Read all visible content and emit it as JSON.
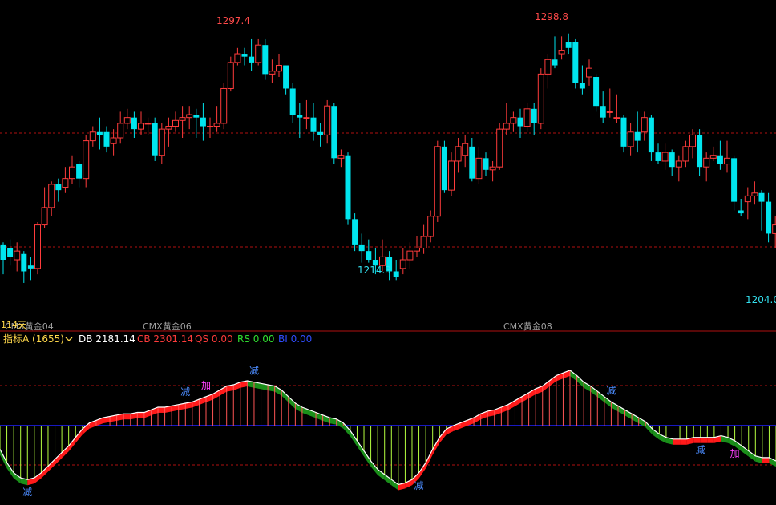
{
  "colors": {
    "background": "#000000",
    "up": "#ff3b3b",
    "down": "#00e5ee",
    "grid": "#b01010",
    "separator": "#b01010",
    "zero_line": "#2020ff",
    "ind_fill_up": "#ff1a1a",
    "ind_fill_down": "#1a8f1a",
    "ind_line": "#ffffff",
    "tick_up": "#ff5555",
    "tick_down": "#b6ff40",
    "label_grey": "#a0a0a0"
  },
  "price_panel": {
    "high_label": "1297.4",
    "high2_label": "1298.8",
    "low_label": "1214.3",
    "low2_label": "1204.0",
    "segment_labels": [
      "CMX黄金04",
      "CMX黄金06",
      "CMX黄金08"
    ],
    "small_overlap_label": "114天"
  },
  "indicator_panel": {
    "name": "指标A (1655)",
    "db_label": "DB 2181.14",
    "cb_label": "CB 2301.14",
    "qs_label": "QS 0.00",
    "rs_label": "RS 0.00",
    "bi_label": "BI 0.00",
    "signals": [
      {
        "text": "减",
        "i": 4,
        "color": "#4c8cff"
      },
      {
        "text": "减",
        "i": 27,
        "color": "#4c8cff"
      },
      {
        "text": "加",
        "i": 30,
        "color": "#ff40ff"
      },
      {
        "text": "减",
        "i": 37,
        "color": "#4c8cff"
      },
      {
        "text": "减",
        "i": 61,
        "color": "#4c8cff"
      },
      {
        "text": "减",
        "i": 89,
        "color": "#4c8cff"
      },
      {
        "text": "减",
        "i": 102,
        "color": "#4c8cff"
      },
      {
        "text": "加",
        "i": 107,
        "color": "#ff40ff"
      }
    ]
  },
  "chart_data": {
    "type": "candlestick",
    "candles": [
      [
        1226,
        1221,
        1227,
        1216
      ],
      [
        1225,
        1222,
        1228,
        1219
      ],
      [
        1221,
        1224,
        1227,
        1217
      ],
      [
        1223,
        1217,
        1224,
        1213
      ],
      [
        1219,
        1218,
        1222,
        1214
      ],
      [
        1218,
        1233,
        1234,
        1216
      ],
      [
        1233,
        1239,
        1246,
        1232
      ],
      [
        1239,
        1247,
        1248,
        1236
      ],
      [
        1247,
        1245,
        1249,
        1241
      ],
      [
        1246,
        1249,
        1253,
        1244
      ],
      [
        1249,
        1253,
        1257,
        1247
      ],
      [
        1254,
        1249,
        1255,
        1246
      ],
      [
        1249,
        1262,
        1264,
        1246
      ],
      [
        1262,
        1265,
        1267,
        1260
      ],
      [
        1265,
        1264,
        1270,
        1259
      ],
      [
        1265,
        1260,
        1267,
        1258
      ],
      [
        1261,
        1263,
        1266,
        1257
      ],
      [
        1263,
        1268,
        1272,
        1261
      ],
      [
        1268,
        1270,
        1273,
        1266
      ],
      [
        1270,
        1266,
        1272,
        1263
      ],
      [
        1266,
        1268,
        1272,
        1264
      ],
      [
        1268,
        1268,
        1270,
        1264
      ],
      [
        1268,
        1257,
        1270,
        1255
      ],
      [
        1257,
        1266,
        1268,
        1254
      ],
      [
        1266,
        1267,
        1270,
        1260
      ],
      [
        1267,
        1269,
        1272,
        1265
      ],
      [
        1269,
        1270,
        1274,
        1263
      ],
      [
        1270,
        1271,
        1274,
        1266
      ],
      [
        1271,
        1270,
        1273,
        1263
      ],
      [
        1270,
        1267,
        1275,
        1262
      ],
      [
        1267,
        1267,
        1270,
        1263
      ],
      [
        1267,
        1268,
        1274,
        1265
      ],
      [
        1268,
        1280,
        1282,
        1266
      ],
      [
        1280,
        1289,
        1291,
        1279
      ],
      [
        1289,
        1292,
        1294,
        1288
      ],
      [
        1292,
        1291,
        1294,
        1288
      ],
      [
        1291,
        1289,
        1297,
        1286
      ],
      [
        1289,
        1295,
        1297,
        1288
      ],
      [
        1295,
        1285,
        1297,
        1283
      ],
      [
        1285,
        1286,
        1290,
        1282
      ],
      [
        1286,
        1288,
        1292,
        1284
      ],
      [
        1288,
        1280,
        1288,
        1278
      ],
      [
        1280,
        1271,
        1282,
        1268
      ],
      [
        1271,
        1270,
        1275,
        1263
      ],
      [
        1270,
        1270,
        1276,
        1266
      ],
      [
        1270,
        1265,
        1275,
        1262
      ],
      [
        1265,
        1264,
        1268,
        1260
      ],
      [
        1264,
        1274,
        1276,
        1261
      ],
      [
        1274,
        1256,
        1275,
        1254
      ],
      [
        1256,
        1257,
        1259,
        1253
      ],
      [
        1257,
        1235,
        1258,
        1233
      ],
      [
        1235,
        1226,
        1237,
        1224
      ],
      [
        1226,
        1224,
        1230,
        1220
      ],
      [
        1224,
        1221,
        1228,
        1220
      ],
      [
        1221,
        1219,
        1225,
        1216
      ],
      [
        1219,
        1222,
        1228,
        1217
      ],
      [
        1222,
        1217,
        1224,
        1214
      ],
      [
        1217,
        1215,
        1221,
        1214
      ],
      [
        1218,
        1221,
        1225,
        1216
      ],
      [
        1221,
        1224,
        1227,
        1218
      ],
      [
        1224,
        1225,
        1229,
        1222
      ],
      [
        1225,
        1229,
        1233,
        1223
      ],
      [
        1229,
        1236,
        1238,
        1227
      ],
      [
        1236,
        1260,
        1262,
        1234
      ],
      [
        1260,
        1245,
        1262,
        1244
      ],
      [
        1245,
        1255,
        1258,
        1243
      ],
      [
        1255,
        1260,
        1263,
        1251
      ],
      [
        1257,
        1261,
        1264,
        1253
      ],
      [
        1260,
        1249,
        1263,
        1248
      ],
      [
        1249,
        1256,
        1260,
        1247
      ],
      [
        1256,
        1252,
        1258,
        1250
      ],
      [
        1252,
        1253,
        1255,
        1248
      ],
      [
        1253,
        1266,
        1268,
        1252
      ],
      [
        1266,
        1268,
        1275,
        1264
      ],
      [
        1268,
        1270,
        1272,
        1265
      ],
      [
        1270,
        1267,
        1273,
        1263
      ],
      [
        1267,
        1273,
        1275,
        1265
      ],
      [
        1273,
        1268,
        1275,
        1264
      ],
      [
        1268,
        1285,
        1287,
        1266
      ],
      [
        1285,
        1290,
        1292,
        1280
      ],
      [
        1290,
        1288,
        1298,
        1287
      ],
      [
        1292,
        1293,
        1298,
        1290
      ],
      [
        1296,
        1294,
        1299,
        1292
      ],
      [
        1296,
        1282,
        1297,
        1280
      ],
      [
        1282,
        1280,
        1288,
        1278
      ],
      [
        1284,
        1287,
        1290,
        1281
      ],
      [
        1284,
        1274,
        1285,
        1272
      ],
      [
        1274,
        1270,
        1279,
        1268
      ],
      [
        1272,
        1272,
        1280,
        1270
      ],
      [
        1270,
        1270,
        1278,
        1268
      ],
      [
        1270,
        1260,
        1271,
        1258
      ],
      [
        1260,
        1265,
        1268,
        1257
      ],
      [
        1265,
        1262,
        1272,
        1258
      ],
      [
        1265,
        1270,
        1272,
        1262
      ],
      [
        1270,
        1258,
        1271,
        1255
      ],
      [
        1258,
        1255,
        1261,
        1254
      ],
      [
        1255,
        1258,
        1261,
        1252
      ],
      [
        1258,
        1253,
        1259,
        1250
      ],
      [
        1253,
        1255,
        1257,
        1248
      ],
      [
        1255,
        1260,
        1262,
        1253
      ],
      [
        1260,
        1264,
        1266,
        1256
      ],
      [
        1264,
        1253,
        1266,
        1250
      ],
      [
        1253,
        1256,
        1258,
        1248
      ],
      [
        1256,
        1257,
        1260,
        1255
      ],
      [
        1257,
        1254,
        1262,
        1252
      ],
      [
        1254,
        1256,
        1262,
        1251
      ],
      [
        1256,
        1241,
        1257,
        1238
      ],
      [
        1238,
        1237,
        1242,
        1236
      ],
      [
        1241,
        1243,
        1246,
        1235
      ],
      [
        1243,
        1244,
        1248,
        1240
      ],
      [
        1244,
        1241,
        1245,
        1231
      ],
      [
        1241,
        1230,
        1244,
        1227
      ],
      [
        1230,
        1233,
        1236,
        1225
      ]
    ],
    "indicator": [
      -14,
      -22,
      -28,
      -31,
      -32,
      -31,
      -28,
      -24,
      -20,
      -16,
      -12,
      -7,
      -2,
      2,
      4,
      6,
      7,
      8,
      9,
      9,
      10,
      10,
      12,
      14,
      14,
      15,
      16,
      17,
      18,
      20,
      22,
      24,
      27,
      30,
      31,
      33,
      34,
      33,
      32,
      31,
      30,
      27,
      22,
      17,
      14,
      12,
      10,
      8,
      6,
      5,
      2,
      -3,
      -9,
      -15,
      -21,
      -26,
      -29,
      -32,
      -35,
      -34,
      -32,
      -28,
      -22,
      -14,
      -7,
      -2,
      0,
      2,
      4,
      6,
      9,
      11,
      12,
      14,
      16,
      19,
      22,
      25,
      28,
      30,
      34,
      38,
      40,
      42,
      38,
      33,
      30,
      26,
      22,
      18,
      15,
      12,
      9,
      6,
      3,
      -2,
      -5,
      -7,
      -8,
      -8,
      -8,
      -7,
      -7,
      -7,
      -7,
      -6,
      -7,
      -9,
      -12,
      -15,
      -18,
      -19,
      -19,
      -21
    ],
    "y_range": [
      1200,
      1305
    ],
    "indicator_range": [
      -40,
      48
    ]
  }
}
